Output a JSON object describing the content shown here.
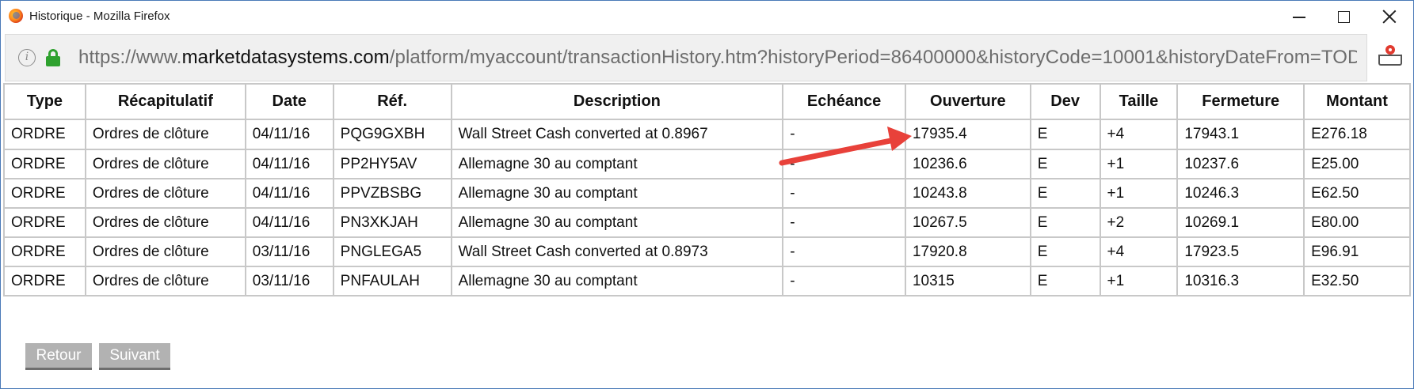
{
  "window": {
    "title": "Historique - Mozilla Firefox"
  },
  "address_bar": {
    "url_prefix": "https://www.",
    "url_domain": "marketdatasystems.com",
    "url_path": "/platform/myaccount/transactionHistory.htm?historyPeriod=86400000&historyCode=10001&historyDateFrom=TOD"
  },
  "table": {
    "headers": [
      "Type",
      "Récapitulatif",
      "Date",
      "Réf.",
      "Description",
      "Echéance",
      "Ouverture",
      "Dev",
      "Taille",
      "Fermeture",
      "Montant"
    ],
    "rows": [
      [
        "ORDRE",
        "Ordres de clôture",
        "04/11/16",
        "PQG9GXBH",
        "Wall Street Cash converted at 0.8967",
        "-",
        "17935.4",
        "E",
        "+4",
        "17943.1",
        "E276.18"
      ],
      [
        "ORDRE",
        "Ordres de clôture",
        "04/11/16",
        "PP2HY5AV",
        "Allemagne 30 au comptant",
        "-",
        "10236.6",
        "E",
        "+1",
        "10237.6",
        "E25.00"
      ],
      [
        "ORDRE",
        "Ordres de clôture",
        "04/11/16",
        "PPVZBSBG",
        "Allemagne 30 au comptant",
        "-",
        "10243.8",
        "E",
        "+1",
        "10246.3",
        "E62.50"
      ],
      [
        "ORDRE",
        "Ordres de clôture",
        "04/11/16",
        "PN3XKJAH",
        "Allemagne 30 au comptant",
        "-",
        "10267.5",
        "E",
        "+2",
        "10269.1",
        "E80.00"
      ],
      [
        "ORDRE",
        "Ordres de clôture",
        "03/11/16",
        "PNGLEGA5",
        "Wall Street Cash converted at 0.8973",
        "-",
        "17920.8",
        "E",
        "+4",
        "17923.5",
        "E96.91"
      ],
      [
        "ORDRE",
        "Ordres de clôture",
        "03/11/16",
        "PNFAULAH",
        "Allemagne 30 au comptant",
        "-",
        "10315",
        "E",
        "+1",
        "10316.3",
        "E32.50"
      ]
    ]
  },
  "buttons": {
    "prev_label": "Retour",
    "next_label": "Suivant"
  },
  "annotation": {
    "arrow_color": "#e8413a"
  },
  "icons": {
    "browser": "firefox-icon",
    "info": "info-icon",
    "lock": "lock-icon",
    "pocket": "pocket-icon",
    "minimize": "minimize-icon",
    "maximize": "maximize-icon",
    "close": "close-icon"
  }
}
